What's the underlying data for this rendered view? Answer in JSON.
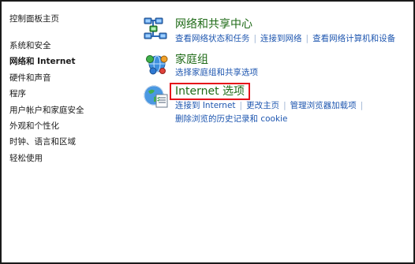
{
  "nav": {
    "home": "控制面板主页",
    "items": [
      {
        "label": "系统和安全",
        "selected": false
      },
      {
        "label": "网络和 Internet",
        "selected": true
      },
      {
        "label": "硬件和声音",
        "selected": false
      },
      {
        "label": "程序",
        "selected": false
      },
      {
        "label": "用户帐户和家庭安全",
        "selected": false
      },
      {
        "label": "外观和个性化",
        "selected": false
      },
      {
        "label": "时钟、语言和区域",
        "selected": false
      },
      {
        "label": "轻松使用",
        "selected": false
      }
    ]
  },
  "categories": {
    "network": {
      "title": "网络和共享中心",
      "icon": "network-sharing-icon",
      "links": [
        "查看网络状态和任务",
        "连接到网络",
        "查看网络计算机和设备"
      ]
    },
    "homegroup": {
      "title": "家庭组",
      "icon": "homegroup-icon",
      "links": [
        "选择家庭组和共享选项"
      ]
    },
    "internet_options": {
      "title": "Internet 选项",
      "icon": "internet-options-icon",
      "highlight_color": "#e5121a",
      "links": [
        "连接到 Internet",
        "更改主页",
        "管理浏览器加载项"
      ],
      "links2": [
        "删除浏览的历史记录和 cookie"
      ]
    }
  },
  "colors": {
    "category_title": "#1e6a16",
    "link": "#1f57b0",
    "text": "#1a1a1a",
    "highlight_border": "#e5121a"
  }
}
